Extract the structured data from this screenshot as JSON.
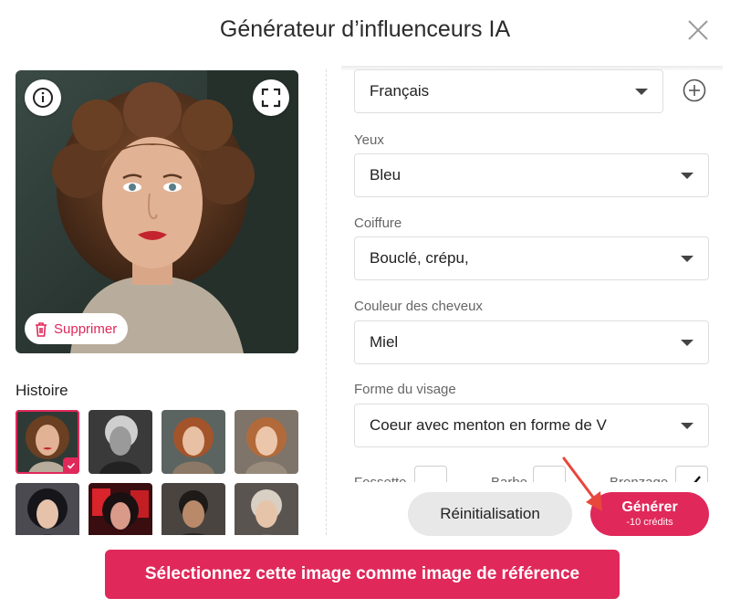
{
  "dialog": {
    "title": "Générateur d’influenceurs IA",
    "close_icon": "close-icon"
  },
  "preview": {
    "delete_label": "Supprimer",
    "icons": [
      "info-icon",
      "expand-icon",
      "trash-icon"
    ]
  },
  "history": {
    "title": "Histoire",
    "thumbnails": [
      {
        "selected": true
      },
      {
        "selected": false
      },
      {
        "selected": false
      },
      {
        "selected": false
      },
      {
        "selected": false
      },
      {
        "selected": false
      },
      {
        "selected": false
      },
      {
        "selected": false
      }
    ]
  },
  "form": {
    "language": {
      "value": "Français"
    },
    "eyes": {
      "label": "Yeux",
      "value": "Bleu"
    },
    "hairstyle": {
      "label": "Coiffure",
      "value": "Bouclé, crépu,"
    },
    "hair_color": {
      "label": "Couleur des cheveux",
      "value": "Miel"
    },
    "face_shape": {
      "label": "Forme du visage",
      "value": "Coeur avec menton en forme de V"
    },
    "toggles": [
      {
        "label": "Fossette",
        "checked": false
      },
      {
        "label": "Barbe",
        "checked": false
      },
      {
        "label": "Bronzage",
        "checked": true
      }
    ]
  },
  "actions": {
    "reset_label": "Réinitialisation",
    "generate_label": "Générer",
    "generate_cost": "-10 crédits",
    "select_reference_label": "Sélectionnez cette image comme image de référence"
  },
  "colors": {
    "accent": "#e0285a",
    "reset_bg": "#e8e8e8",
    "arrow": "#e8473c"
  }
}
